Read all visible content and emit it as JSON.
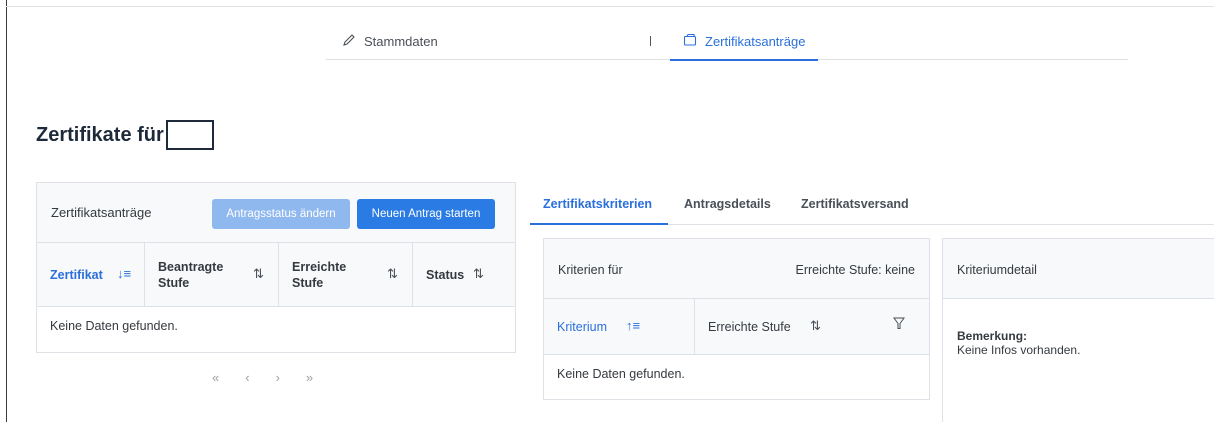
{
  "nav": {
    "tabs": [
      {
        "label": "Stammdaten",
        "icon": "pencil-icon"
      },
      {
        "label": "Zertifikatsanträge",
        "icon": "folder-icon",
        "active": true
      }
    ]
  },
  "page": {
    "title": "Zertifikate für"
  },
  "left_panel": {
    "title": "Zertifikatsanträge",
    "btn_status": "Antragsstatus ändern",
    "btn_new": "Neuen Antrag starten",
    "columns": [
      {
        "l1": "Zertifikat",
        "l2": ""
      },
      {
        "l1": "Beantragte",
        "l2": "Stufe"
      },
      {
        "l1": "Erreichte",
        "l2": "Stufe"
      },
      {
        "l1": "Status",
        "l2": ""
      }
    ],
    "empty": "Keine Daten gefunden.",
    "pager": [
      "«",
      "‹",
      "›",
      "»"
    ]
  },
  "right_tabs": [
    "Zertifikatskriterien",
    "Antragsdetails",
    "Zertifikatsversand"
  ],
  "criteria": {
    "header_left": "Kriterien für",
    "header_right": "Erreichte Stufe: keine",
    "col1": "Kriterium",
    "col2": "Erreichte Stufe",
    "empty": "Keine Daten gefunden."
  },
  "detail": {
    "title": "Kriteriumdetail",
    "label": "Bemerkung:",
    "value": "Keine Infos vorhanden."
  },
  "colors": {
    "accent": "#2a6fdb",
    "primary_button": "#2a7be4",
    "disabled_button": "#8fb8ef"
  }
}
